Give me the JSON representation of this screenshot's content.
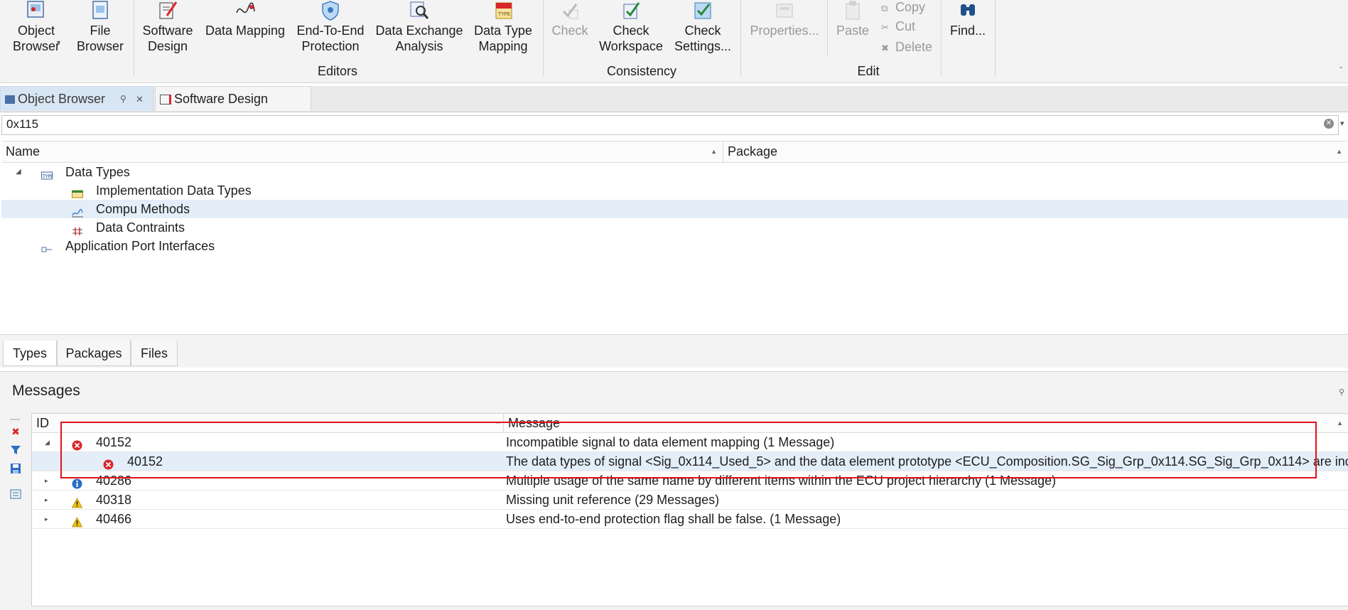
{
  "ribbon": {
    "editors": {
      "object_browser": "Object Browser",
      "file_browser": "File Browser",
      "software_design": "Software Design",
      "data_mapping": "Data Mapping",
      "e2e_protection": "End-To-End Protection",
      "data_exchange": "Data Exchange Analysis",
      "data_type_mapping": "Data Type Mapping",
      "group_label": "Editors"
    },
    "consistency": {
      "check": "Check",
      "check_workspace": "Check Workspace",
      "check_settings": "Check Settings...",
      "group_label": "Consistency"
    },
    "edit": {
      "properties": "Properties...",
      "paste": "Paste",
      "copy": "Copy",
      "cut": "Cut",
      "delete": "Delete",
      "group_label": "Edit"
    },
    "find": "Find..."
  },
  "doc_tabs": [
    {
      "label": "Object Browser",
      "pin": "⚲",
      "close": "✕"
    },
    {
      "label": "Software Design"
    }
  ],
  "search": {
    "value": "0x115"
  },
  "tree": {
    "columns": [
      "Name",
      "Package"
    ],
    "nodes": [
      {
        "label": "Data Types"
      },
      {
        "label": "Implementation Data Types"
      },
      {
        "label": "Compu Methods"
      },
      {
        "label": "Data Contraints"
      },
      {
        "label": "Application Port Interfaces"
      }
    ]
  },
  "browser_tabs": [
    "Types",
    "Packages",
    "Files"
  ],
  "messages": {
    "title": "Messages",
    "columns": [
      "ID",
      "Message"
    ],
    "rows": [
      {
        "id": "40152",
        "severity": "error",
        "text": "Incompatible signal to data element mapping (1 Message)"
      },
      {
        "id": "40152",
        "severity": "error",
        "text": "The data types of signal <Sig_0x114_Used_5> and the data element prototype <ECU_Composition.SG_Sig_Grp_0x114.SG_Sig_Grp_0x114> are inc..."
      },
      {
        "id": "40286",
        "severity": "info",
        "text": "Multiple usage of the same name by different items within the ECU project hierarchy (1 Message)"
      },
      {
        "id": "40318",
        "severity": "warning",
        "text": "Missing unit reference (29 Messages)"
      },
      {
        "id": "40466",
        "severity": "warning",
        "text": "Uses end-to-end protection flag shall be false. (1 Message)"
      }
    ]
  },
  "colors": {
    "error": "#d9262b",
    "warning": "#f0c20f",
    "info": "#2a6cc4",
    "selection": "#e3eef9",
    "highlight": "#e0111b"
  }
}
